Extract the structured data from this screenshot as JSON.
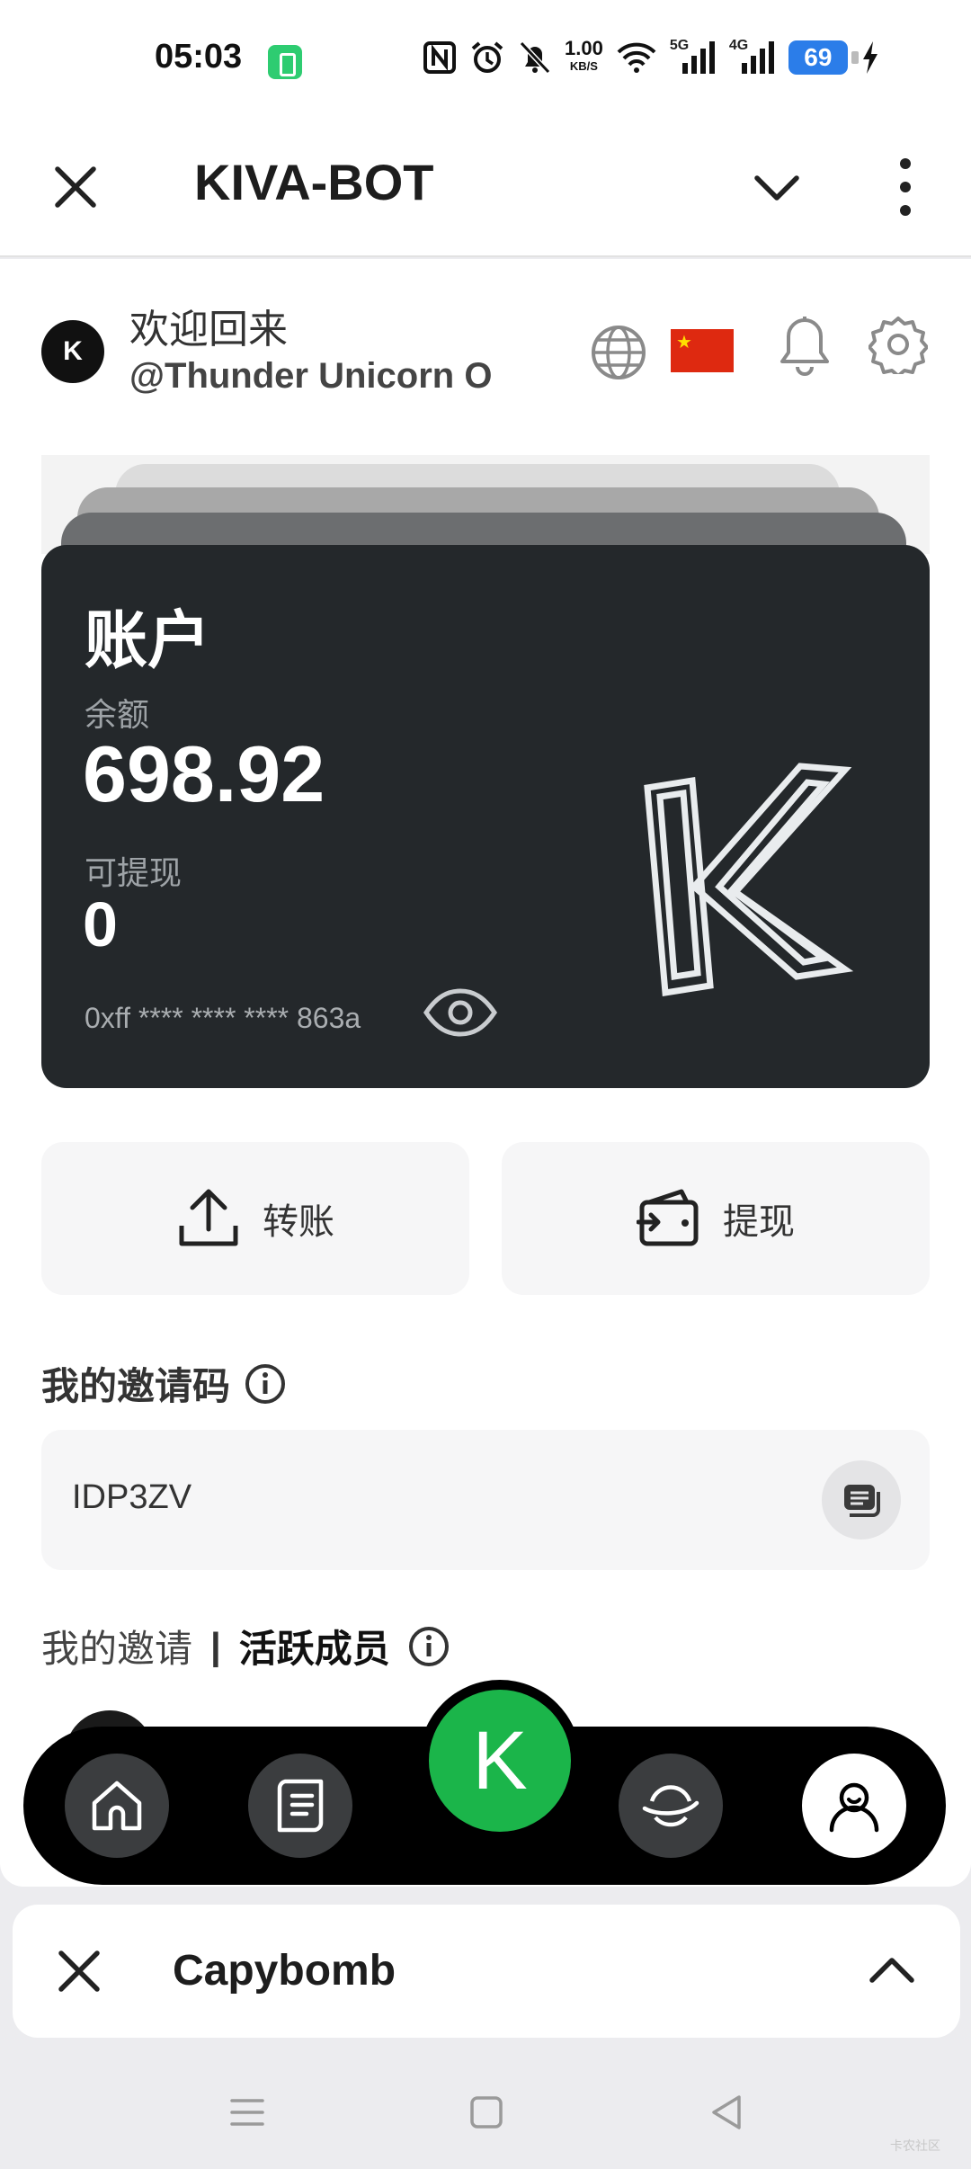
{
  "status_bar": {
    "time": "05:03",
    "net_speed_value": "1.00",
    "net_speed_unit": "KB/S",
    "net_5g": "5G",
    "net_4g": "4G",
    "battery": "69"
  },
  "appbar": {
    "title": "KIVA-BOT"
  },
  "header": {
    "welcome": "欢迎回来",
    "username": "@Thunder Unicorn O",
    "avatar_letter": "K"
  },
  "account": {
    "title": "账户",
    "balance_label": "余额",
    "balance": "698.92",
    "withdrawable_label": "可提现",
    "withdrawable": "0",
    "address": "0xff **** **** **** 863a"
  },
  "actions": {
    "transfer": "转账",
    "withdraw": "提现"
  },
  "invite": {
    "section_title": "我的邀请码",
    "code": "IDP3ZV",
    "my_invites": "我的邀请",
    "separator": "|",
    "active_members": "活跃成员"
  },
  "bottom_nav": {
    "center_letter": "K"
  },
  "mini_bar": {
    "title": "Capybomb"
  },
  "watermark": "卡农社区",
  "icons": {
    "close": "close-icon",
    "chevron": "chevron-down-icon",
    "more": "more-vertical-icon",
    "globe": "globe-icon",
    "flag": "china-flag-icon",
    "bell": "bell-icon",
    "gear": "gear-icon",
    "eye": "eye-icon",
    "upload": "upload-icon",
    "wallet": "wallet-icon",
    "info": "info-icon",
    "copy": "copy-icon",
    "home": "home-icon",
    "document": "document-icon",
    "planet": "planet-icon",
    "profile": "profile-icon"
  },
  "colors": {
    "card_bg": "#24282b",
    "accent_green": "#1bb54a",
    "flag_red": "#de2910",
    "battery_blue": "#2b7de9"
  }
}
